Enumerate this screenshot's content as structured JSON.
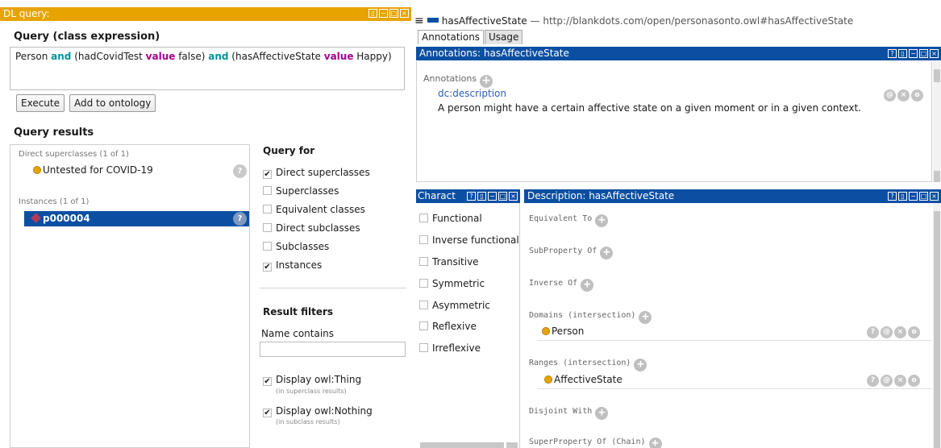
{
  "dl_query": {
    "title": "DL query:",
    "query_heading": "Query (class expression)",
    "expression": [
      {
        "text": "Person ",
        "kind": "plain"
      },
      {
        "text": "and",
        "kind": "and"
      },
      {
        "text": " (hadCovidTest ",
        "kind": "plain"
      },
      {
        "text": "value",
        "kind": "value"
      },
      {
        "text": " false) ",
        "kind": "plain"
      },
      {
        "text": "and",
        "kind": "and"
      },
      {
        "text": " (hasAffectiveState ",
        "kind": "plain"
      },
      {
        "text": "value",
        "kind": "value"
      },
      {
        "text": " Happy)",
        "kind": "plain"
      }
    ],
    "execute_label": "Execute",
    "add_label": "Add to ontology",
    "results_heading": "Query results",
    "direct_superclasses_label": "Direct superclasses (1 of 1)",
    "superclass_item": "Untested for COVID-19",
    "instances_label": "Instances (1 of 1)",
    "instance_item": "p000004",
    "help_glyph": "?",
    "query_for_heading": "Query for",
    "query_for_options": [
      {
        "label": "Direct superclasses",
        "checked": "✔"
      },
      {
        "label": "Superclasses",
        "checked": ""
      },
      {
        "label": "Equivalent classes",
        "checked": ""
      },
      {
        "label": "Direct subclasses",
        "checked": ""
      },
      {
        "label": "Subclasses",
        "checked": ""
      },
      {
        "label": "Instances",
        "checked": "✔"
      }
    ],
    "result_filters_heading": "Result filters",
    "name_contains_label": "Name contains",
    "name_contains_value": "",
    "display_thing_label": "Display owl:Thing",
    "display_thing_hint": "(in superclass results)",
    "display_nothing_label": "Display owl:Nothing",
    "display_nothing_hint": "(in subclass results)",
    "check_glyph": "✔"
  },
  "property_view": {
    "menu_icon": "≡",
    "name": "hasAffectiveState",
    "separator": "—",
    "iri": "http://blankdots.com/open/personasonto.owl#hasAffectiveState",
    "tabs": [
      "Annotations",
      "Usage"
    ],
    "annotations_bar": "Annotations: hasAffectiveState",
    "annotations_label": "Annotations",
    "annotation_property": "dc:description",
    "annotation_value": "A person might have a certain affective state on a given moment or in a given context.",
    "characteristics_bar": "Charact",
    "characteristics": [
      "Functional",
      "Inverse functional",
      "Transitive",
      "Symmetric",
      "Asymmetric",
      "Reflexive",
      "Irreflexive"
    ],
    "description_bar": "Description: hasAffectiveState",
    "equivalent_to": "Equivalent To",
    "subproperty_of": "SubProperty Of",
    "inverse_of": "Inverse Of",
    "domains_label": "Domains (intersection)",
    "domain_item": "Person",
    "ranges_label": "Ranges (intersection)",
    "range_item": "AffectiveState",
    "disjoint_with": "Disjoint With",
    "superproperty_chain": "SuperProperty Of (Chain)"
  },
  "glyphs": {
    "plus": "+",
    "question": "?",
    "at": "@",
    "close": "×",
    "circle": "o"
  },
  "colors": {
    "dl_title_bg": "#e7a400",
    "blue_bar": "#0b4fa2",
    "keyword_and": "#00959c",
    "keyword_value": "#a3008f",
    "selection": "#0b4fa2"
  }
}
